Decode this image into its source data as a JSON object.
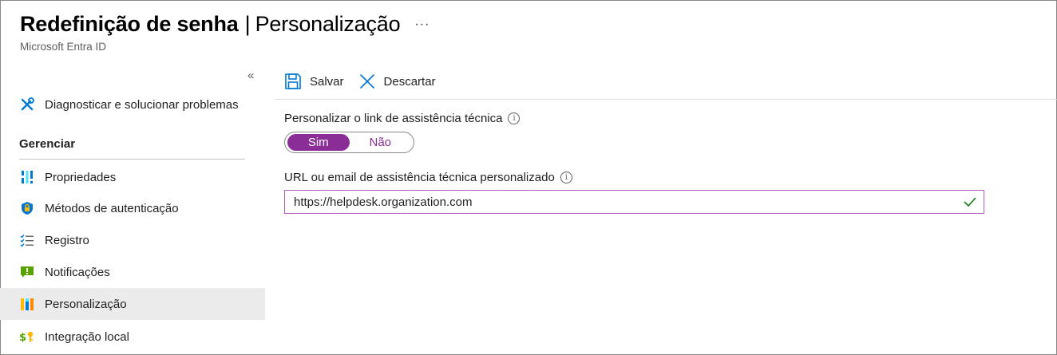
{
  "header": {
    "title_main": "Redefinição de senha",
    "title_separator": "|",
    "title_sub": "Personalização",
    "more_label": "···",
    "subtitle": "Microsoft Entra ID"
  },
  "sidebar": {
    "collapse_label": "«",
    "items": [
      {
        "label": "Diagnosticar e solucionar problemas",
        "icon": "wrench-cross-icon"
      },
      {
        "label": "Propriedades",
        "icon": "properties-bars-icon"
      },
      {
        "label": "Métodos de autenticação",
        "icon": "shield-lock-icon"
      },
      {
        "label": "Registro",
        "icon": "checklist-icon"
      },
      {
        "label": "Notificações",
        "icon": "notification-icon"
      },
      {
        "label": "Personalização",
        "icon": "customization-icon",
        "selected": true
      },
      {
        "label": "Integração local",
        "icon": "on-premises-key-icon"
      }
    ],
    "section_title": "Gerenciar"
  },
  "toolbar": {
    "save_label": "Salvar",
    "discard_label": "Descartar"
  },
  "form": {
    "helpdesk_link_label": "Personalizar o link de assistência técnica",
    "toggle_yes": "Sim",
    "toggle_no": "Não",
    "toggle_selected": "Sim",
    "url_label": "URL ou email de assistência técnica personalizado",
    "url_value": "https://helpdesk.organization.com",
    "info_glyph": "i"
  },
  "colors": {
    "accent": "#8b2d96",
    "selected_bg": "#ebebeb",
    "valid_check": "#107c10",
    "save_icon": "#0078d4"
  }
}
